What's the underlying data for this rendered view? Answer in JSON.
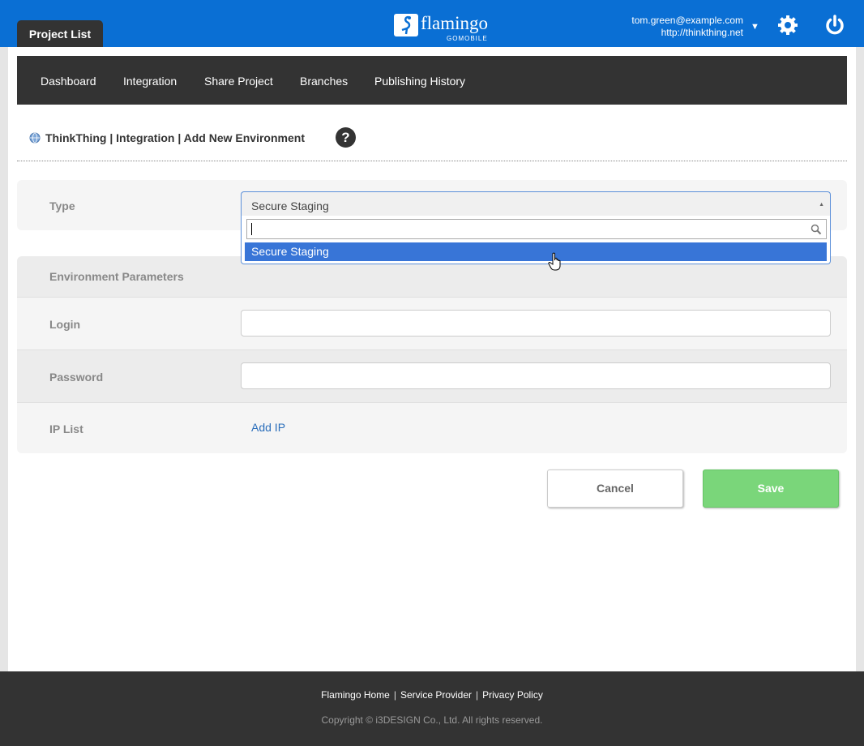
{
  "header": {
    "project_tab": "Project List",
    "logo_text": "flamingo",
    "logo_sub": "GOMOBILE",
    "user_email": "tom.green@example.com",
    "user_site": "http://thinkthing.net",
    "icons": [
      "gear-icon",
      "power-icon"
    ]
  },
  "nav": {
    "items": [
      "Dashboard",
      "Integration",
      "Share Project",
      "Branches",
      "Publishing History"
    ]
  },
  "breadcrumb": {
    "text": "ThinkThing | Integration | Add New Environment",
    "help": "?"
  },
  "form": {
    "type_label": "Type",
    "type_value": "Secure Staging",
    "dropdown_search": "",
    "dropdown_options": [
      "Secure Staging"
    ],
    "params_title": "Environment Parameters",
    "login_label": "Login",
    "login_value": "",
    "password_label": "Password",
    "password_value": "",
    "ip_label": "IP List",
    "add_ip": "Add IP"
  },
  "buttons": {
    "cancel": "Cancel",
    "save": "Save"
  },
  "footer": {
    "links": [
      "Flamingo Home",
      "Service Provider",
      "Privacy Policy"
    ],
    "copyright": "Copyright © i3DESIGN Co., Ltd. All rights reserved."
  },
  "colors": {
    "topbar": "#0a6fd4",
    "nav": "#333333",
    "selected_option": "#3875d7",
    "save": "#7ad67a",
    "link": "#2a6ebb"
  }
}
